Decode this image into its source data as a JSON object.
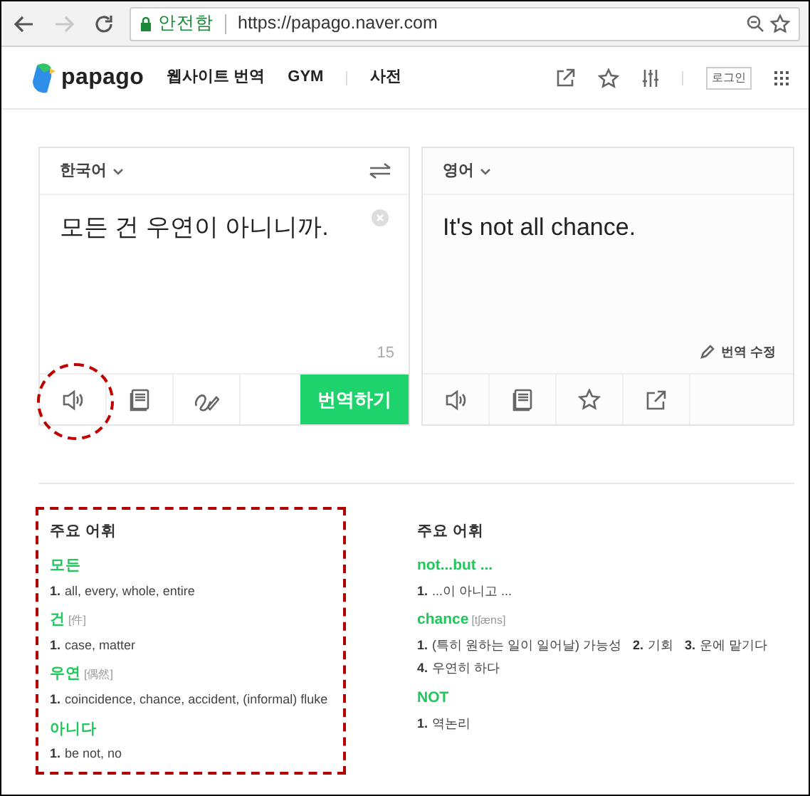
{
  "browser": {
    "nav": [
      {
        "kind": "back",
        "disabled": false
      },
      {
        "kind": "forward",
        "disabled": true
      },
      {
        "kind": "reload",
        "disabled": false
      }
    ],
    "security": "안전함",
    "url": "https://papago.naver.com"
  },
  "header": {
    "logo": "papago",
    "menu": [
      "웹사이트 번역",
      "GYM",
      "사전"
    ],
    "login": "로그인"
  },
  "source": {
    "language": "한국어",
    "text": "모든 건 우연이 아니니까.",
    "count": "15",
    "translate_button": "번역하기",
    "speaker_highlighted": true
  },
  "target": {
    "language": "영어",
    "text": "It's not all chance.",
    "edit": "번역 수정"
  },
  "vocab": [
    {
      "title": "주요 어휘",
      "highlighted": true,
      "entries": [
        {
          "word": "모든",
          "lines": [
            [
              {
                "num": "1.",
                "text": "all, every, whole, entire"
              }
            ]
          ]
        },
        {
          "word": "건",
          "hanja": "[件]",
          "lines": [
            [
              {
                "num": "1.",
                "text": "case, matter"
              }
            ]
          ]
        },
        {
          "word": "우연",
          "hanja": "[偶然]",
          "lines": [
            [
              {
                "num": "1.",
                "text": "coincidence, chance, accident, (informal) fluke"
              }
            ]
          ]
        },
        {
          "word": "아니다",
          "lines": [
            [
              {
                "num": "1.",
                "text": "be not, no"
              }
            ]
          ]
        }
      ]
    },
    {
      "title": "주요 어휘",
      "entries": [
        {
          "word": "not...but ...",
          "lines": [
            [
              {
                "num": "1.",
                "text": "...이 아니고 ..."
              }
            ]
          ]
        },
        {
          "word": "chance",
          "hanja": "[tʃæns]",
          "lines": [
            [
              {
                "num": "1.",
                "text": "(특히 원하는 일이 일어날) 가능성"
              },
              {
                "num": "2.",
                "text": "기회"
              },
              {
                "num": "3.",
                "text": "운에 맡기다"
              }
            ],
            [
              {
                "num": "4.",
                "text": "우연히 하다"
              }
            ]
          ]
        },
        {
          "word": "NOT",
          "lines": [
            [
              {
                "num": "1.",
                "text": "역논리"
              }
            ]
          ]
        }
      ]
    }
  ]
}
